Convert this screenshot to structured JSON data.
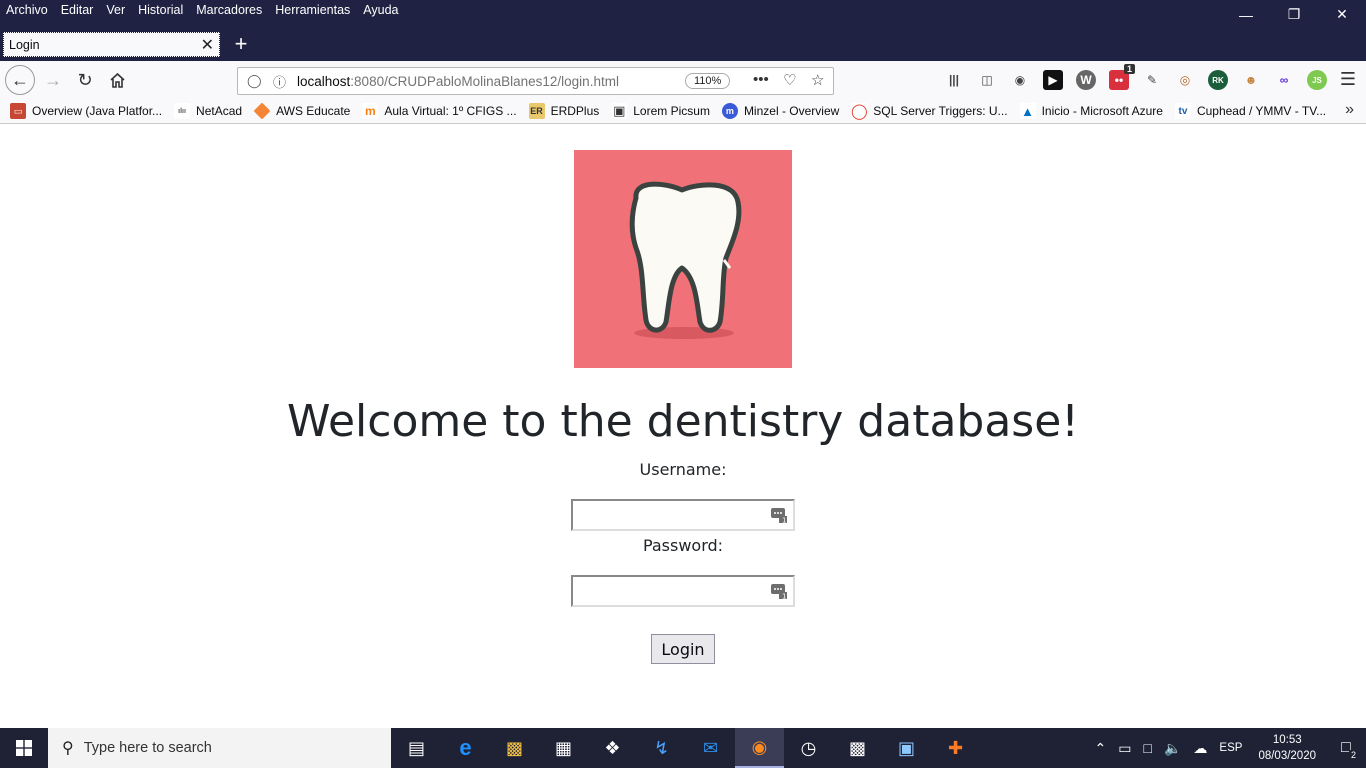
{
  "menu": [
    "Archivo",
    "Editar",
    "Ver",
    "Historial",
    "Marcadores",
    "Herramientas",
    "Ayuda"
  ],
  "tab": {
    "title": "Login"
  },
  "url": {
    "host": "localhost",
    "path": ":8080/CRUDPabloMolinaBlanes12/login.html",
    "zoom": "110%"
  },
  "toolbar": {
    "badge_count": "1"
  },
  "bookmarks": [
    {
      "label": "Overview (Java Platfor...",
      "icon": "oracle-icon",
      "color": "#c74634"
    },
    {
      "label": "NetAcad",
      "icon": "cisco-icon",
      "color": "#555555"
    },
    {
      "label": "AWS Educate",
      "icon": "aws-cube-icon",
      "color": "#f58536"
    },
    {
      "label": "Aula Virtual: 1º CFIGS ...",
      "icon": "moodle-icon",
      "color": "#f98012"
    },
    {
      "label": "ERDPlus",
      "icon": "erdplus-icon",
      "color": "#e8c86a"
    },
    {
      "label": "Lorem Picsum",
      "icon": "camera-icon",
      "color": "#333333"
    },
    {
      "label": "Minzel - Overview",
      "icon": "minzel-icon",
      "color": "#3a5bd9"
    },
    {
      "label": "SQL Server Triggers: U...",
      "icon": "sql-icon",
      "color": "#e23a2a"
    },
    {
      "label": "Inicio - Microsoft Azure",
      "icon": "azure-icon",
      "color": "#0072c6"
    },
    {
      "label": "Cuphead / YMMV - TV...",
      "icon": "tvtropes-icon",
      "color": "#1a5ea8"
    }
  ],
  "page": {
    "heading": "Welcome to the dentistry database!",
    "username_label": "Username:",
    "username_value": "",
    "password_label": "Password:",
    "password_value": "",
    "login_label": "Login",
    "logo_bg": "#f07177"
  },
  "taskbar": {
    "search_placeholder": "Type here to search",
    "language": "ESP",
    "time": "10:53",
    "date": "08/03/2020",
    "notifications": "2"
  }
}
